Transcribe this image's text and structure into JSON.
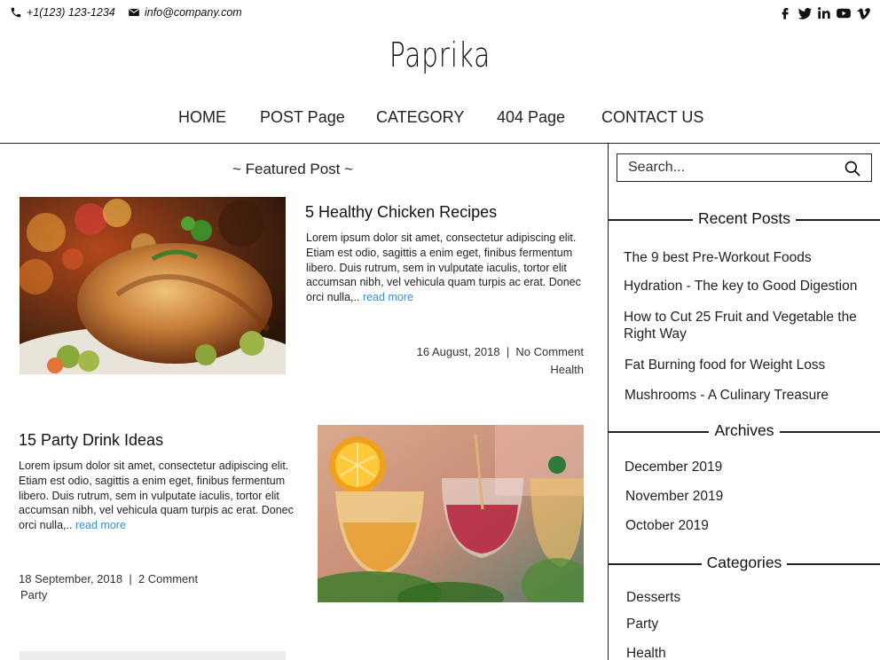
{
  "topbar": {
    "phone": "+1(123) 123-1234",
    "email": "info@company.com",
    "social_icons": [
      "facebook-icon",
      "twitter-icon",
      "linkedin-icon",
      "youtube-icon",
      "vimeo-icon"
    ]
  },
  "brand": "Paprika",
  "nav": [
    "HOME",
    "POST Page",
    "CATEGORY",
    "404 Page",
    "CONTACT US"
  ],
  "featured_heading": "~ Featured Post ~",
  "posts": [
    {
      "title": "5 Healthy Chicken Recipes",
      "excerpt": "Lorem ipsum dolor sit amet, consectetur adipiscing elit. Etiam est odio, sagittis a enim eget, finibus fermentum libero. Duis rutrum, sem in vulputate iaculis, tortor elit accumsan nibh, vel vehicula quam turpis ac erat. Donec orci nulla,..",
      "read_more": "read more",
      "meta": "16 August, 2018  |  No Comment",
      "category": "Health"
    },
    {
      "title": "15 Party Drink Ideas",
      "excerpt": "Lorem ipsum dolor sit amet, consectetur adipiscing elit. Etiam est odio, sagittis a enim eget, finibus fermentum libero. Duis rutrum, sem in vulputate iaculis, tortor elit accumsan nibh, vel vehicula quam turpis ac erat. Donec orci nulla,..",
      "read_more": "read more",
      "meta": "18 September, 2018  |  2 Comment",
      "category": "Party"
    }
  ],
  "sidebar": {
    "search_placeholder": "Search...",
    "recent_heading": "Recent Posts",
    "recent_posts": [
      "The 9 best Pre-Workout Foods",
      "Hydration - The key to Good Digestion",
      "How to Cut 25 Fruit and Vegetable the Right Way",
      "Fat Burning food for Weight Loss",
      "Mushrooms - A Culinary Treasure"
    ],
    "archives_heading": "Archives",
    "archives": [
      "December 2019",
      "November 2019",
      "October 2019"
    ],
    "categories_heading": "Categories",
    "categories": [
      "Desserts",
      "Party",
      "Health"
    ]
  },
  "colors": {
    "link": "#3a8fd8",
    "text": "#222222",
    "rule": "#222222"
  }
}
